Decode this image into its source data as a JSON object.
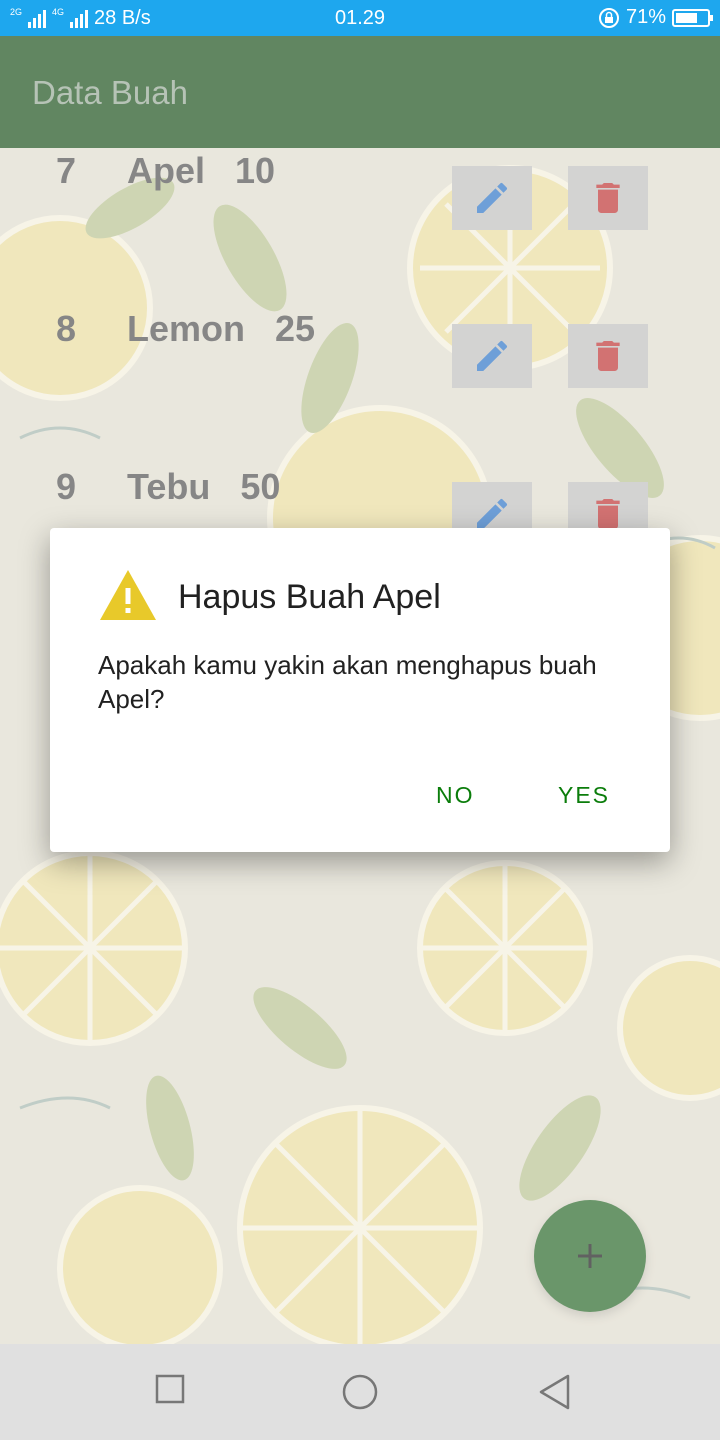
{
  "status_bar": {
    "network_left": "2G",
    "network_right": "4G",
    "speed": "28 B/s",
    "time": "01.29",
    "battery": "71%",
    "battery_level": 0.71
  },
  "app_bar": {
    "title": "Data Buah"
  },
  "rows": [
    {
      "no": "7",
      "name": "Apel",
      "qty": "10"
    },
    {
      "no": "8",
      "name": "Lemon",
      "qty": "25"
    },
    {
      "no": "9",
      "name": "Tebu",
      "qty": "50"
    }
  ],
  "icons": {
    "edit": "pencil-icon",
    "delete": "trash-icon",
    "warning": "warning-icon",
    "fab": "plus-icon",
    "nav": [
      "square-icon",
      "circle-icon",
      "triangle-back-icon"
    ]
  },
  "dialog": {
    "title": "Hapus Buah Apel",
    "message": "Apakah kamu yakin akan menghapus buah Apel?",
    "no_label": "NO",
    "yes_label": "YES"
  },
  "colors": {
    "status_bar": "#1ea7ee",
    "app_bar": "#003c00",
    "accent": "#0b7d0b",
    "edit_icon": "#1565c0",
    "delete_icon": "#b71c1c",
    "warning": "#e8c92a",
    "fab": "#0f560f"
  }
}
